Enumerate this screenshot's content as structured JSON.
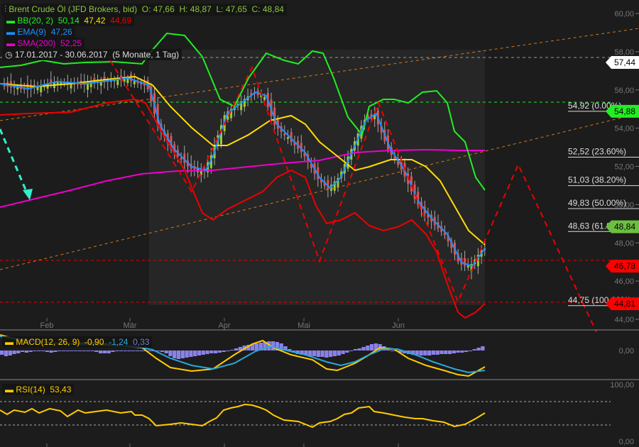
{
  "chart_data": {
    "type": "line",
    "title": "Brent Crude Öl (JFD Brokers, bid)",
    "ohlc": {
      "open": "O: 47,66",
      "high": "H: 48,87",
      "low": "L: 47,65",
      "close": "C: 48,84"
    },
    "period": "17.01.2017 - 30.06.2017",
    "period_detail": "(5 Monate, 1 Tag)",
    "indicators": {
      "bb": {
        "label": "BB(20, 2)",
        "upper": "50,14",
        "middle": "47,42",
        "lower": "44,69",
        "colors": [
          "#22ee22",
          "#ffdd00",
          "#ee0000"
        ]
      },
      "ema": {
        "label": "EMA(9)",
        "value": "47,26",
        "color": "#1e90ff"
      },
      "sma": {
        "label": "SMA(200)",
        "value": "52,25",
        "color": "#ee00cc"
      }
    },
    "x_ticks": [
      "Feb",
      "Mär",
      "Apr",
      "Mai",
      "Jun"
    ],
    "y_ticks": [
      "60,00",
      "58,00",
      "56,00",
      "54,00",
      "52,00",
      "50,00",
      "48,00",
      "46,00",
      "44,00"
    ],
    "ylim": [
      44,
      60
    ],
    "price_tags": [
      {
        "value": "57,44",
        "color": "#ffffff"
      },
      {
        "value": "54,88",
        "color": "#22ee22"
      },
      {
        "value": "48,84",
        "color": "#6cc040"
      },
      {
        "value": "46,78",
        "color": "#ff0000"
      },
      {
        "value": "44,81",
        "color": "#ff0000"
      }
    ],
    "fibonacci": [
      {
        "label": "54,92 (0.00%)",
        "value": 54.92
      },
      {
        "label": "52,52 (23.60%)",
        "value": 52.52
      },
      {
        "label": "51,03 (38.20%)",
        "value": 51.03
      },
      {
        "label": "49,83 (50.00%)",
        "value": 49.83
      },
      {
        "label": "48,63 (61.80%)",
        "value": 48.63
      },
      {
        "label": "44,75 (100.00%)",
        "value": 44.75
      }
    ],
    "macd": {
      "label": "MACD(12, 26, 9)",
      "macd": "-0,90",
      "signal": "-1,24",
      "hist": "0,33",
      "y_ticks": [
        "0,00"
      ]
    },
    "rsi": {
      "label": "RSI(14)",
      "value": "53,43",
      "y_ticks": [
        "100,00",
        "0,00"
      ],
      "levels": [
        70,
        30
      ]
    }
  }
}
